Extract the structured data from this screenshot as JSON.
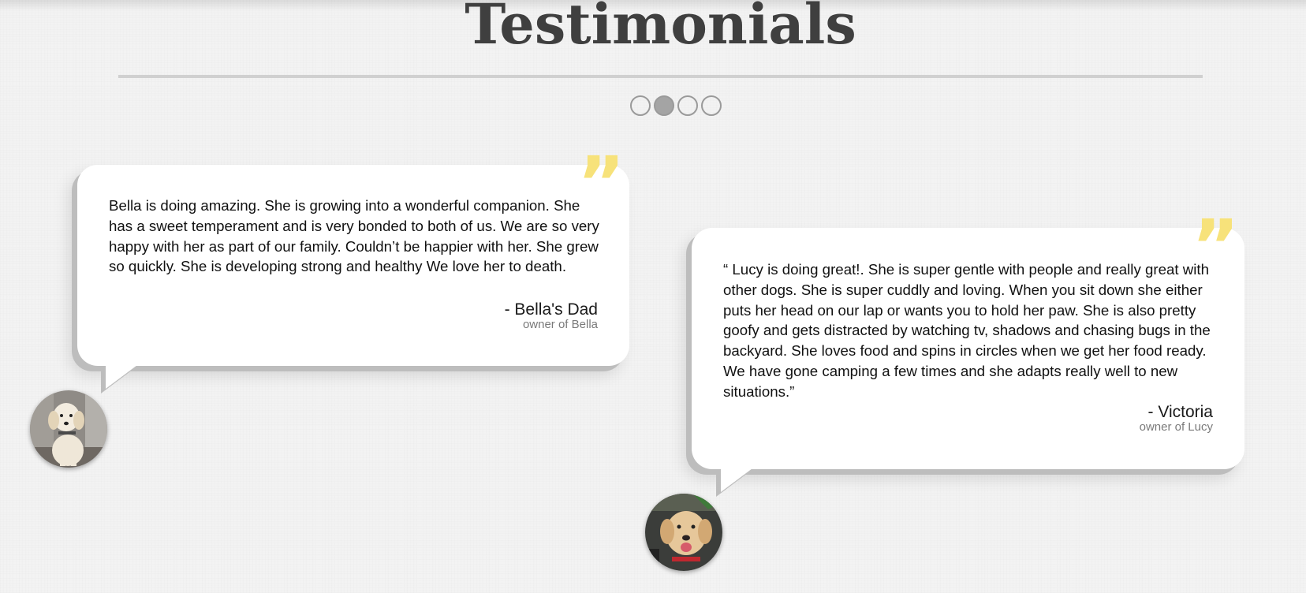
{
  "header": {
    "title": "Testimonials"
  },
  "carousel": {
    "dots": 4,
    "active_index": 1
  },
  "testimonials": [
    {
      "text": "Bella is doing amazing. She is growing into a wonderful companion. She has a sweet temperament and is very bonded to both of us. We are so very happy with her as part of our family. Couldn’t be happier with her. She grew so quickly. She is developing strong and healthy We love her to death.",
      "author": "- Bella's Dad",
      "subtitle": "owner of Bella",
      "quote_icon": "closing-quote-icon",
      "avatar": "golden-retriever-puppy-photo"
    },
    {
      "text": "“ Lucy is doing great!. She is super gentle with people and really great with other dogs. She is super cuddly and loving. When you sit down she either puts her head on our lap or wants you to hold her paw. She is also pretty goofy and gets distracted by watching tv, shadows and chasing bugs in the backyard. She loves food and spins in circles when we get her food ready. We have gone camping a few times and she adapts really well to new situations.”",
      "author": "- Victoria",
      "subtitle": "owner of Lucy",
      "quote_icon": "closing-quote-icon",
      "avatar": "golden-retriever-dog-photo"
    }
  ],
  "colors": {
    "title": "#3f3f3f",
    "quote_accent": "#f7e27a",
    "background": "#f3f3f3",
    "card": "#ffffff",
    "card_shadow": "#bdbdbd"
  }
}
